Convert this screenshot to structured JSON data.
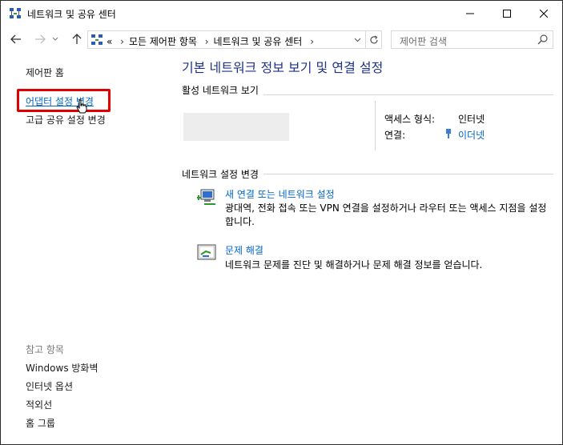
{
  "window": {
    "title": "네트워크 및 공유 센터"
  },
  "navigation": {
    "breadcrumb_prefix": "«",
    "breadcrumb": [
      "모든 제어판 항목",
      "네트워크 및 공유 센터"
    ],
    "breadcrumb_separator": "›",
    "search_placeholder": "제어판 검색"
  },
  "sidebar": {
    "home": "제어판 홈",
    "links": [
      "어댑터 설정 변경",
      "고급 공유 설정 변경"
    ],
    "see_also_header": "참고 항목",
    "see_also": [
      "Windows 방화벽",
      "인터넷 옵션",
      "적외선",
      "홈 그룹"
    ]
  },
  "main": {
    "title": "기본 네트워크 정보 보기 및 연결 설정",
    "active_networks_label": "활성 네트워크 보기",
    "access_type_label": "액세스 형식:",
    "access_type_value": "인터넷",
    "connections_label": "연결:",
    "connections_value": "이더넷",
    "change_settings_label": "네트워크 설정 변경",
    "tasks": [
      {
        "link": "새 연결 또는 네트워크 설정",
        "description": "광대역, 전화 접속 또는 VPN 연결을 설정하거나 라우터 또는 액세스 지점을 설정합니다."
      },
      {
        "link": "문제 해결",
        "description": "네트워크 문제를 진단 및 해결하거나 문제 해결 정보를 얻습니다."
      }
    ]
  },
  "colors": {
    "link": "#0066cc",
    "title": "#1e3287",
    "highlight": "#e00000"
  }
}
